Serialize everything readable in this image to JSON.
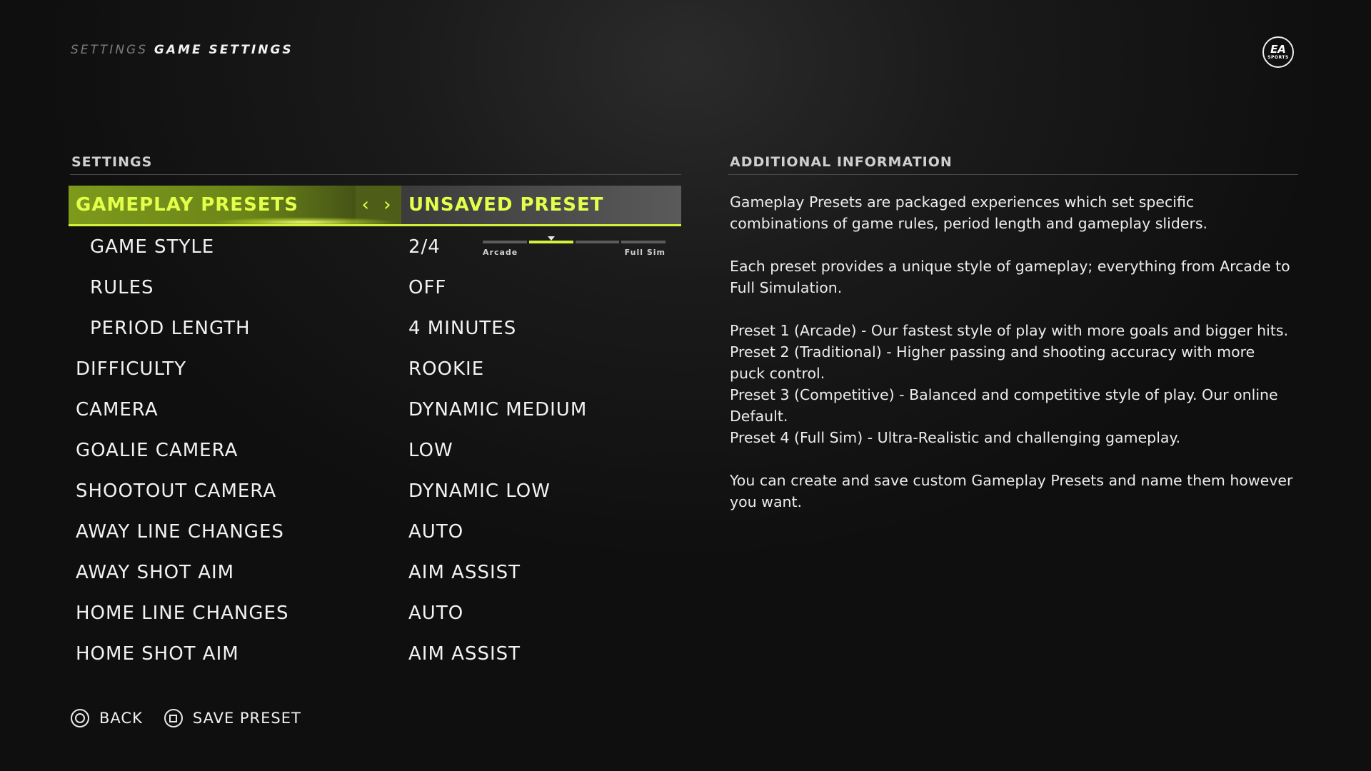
{
  "breadcrumb": {
    "parent": "SETTINGS",
    "current": "GAME SETTINGS"
  },
  "logo": {
    "line1": "EA",
    "line2": "SPORTS"
  },
  "settings_header": "SETTINGS",
  "info_header": "ADDITIONAL INFORMATION",
  "selected_row": {
    "label": "GAMEPLAY PRESETS",
    "value": "UNSAVED PRESET",
    "arrows": "‹ ›"
  },
  "game_style": {
    "label": "GAME STYLE",
    "value": "2/4",
    "slider_min_label": "Arcade",
    "slider_max_label": "Full Sim",
    "level": 2,
    "steps": 4
  },
  "rows": [
    {
      "label": "RULES",
      "value": "OFF",
      "sub": true
    },
    {
      "label": "PERIOD LENGTH",
      "value": "4 MINUTES",
      "sub": true
    },
    {
      "label": "DIFFICULTY",
      "value": "ROOKIE",
      "sub": false
    },
    {
      "label": "CAMERA",
      "value": "DYNAMIC MEDIUM",
      "sub": false
    },
    {
      "label": "GOALIE CAMERA",
      "value": "LOW",
      "sub": false
    },
    {
      "label": "SHOOTOUT CAMERA",
      "value": "DYNAMIC LOW",
      "sub": false
    },
    {
      "label": "AWAY LINE CHANGES",
      "value": "AUTO",
      "sub": false
    },
    {
      "label": "AWAY SHOT AIM",
      "value": "AIM ASSIST",
      "sub": false
    },
    {
      "label": "HOME LINE CHANGES",
      "value": "AUTO",
      "sub": false
    },
    {
      "label": "HOME SHOT AIM",
      "value": "AIM ASSIST",
      "sub": false
    }
  ],
  "info": {
    "p1": "Gameplay Presets are packaged experiences which set specific combinations of game rules, period length and gameplay sliders.",
    "p2": "Each preset provides a unique style of gameplay; everything from Arcade to Full Simulation.",
    "presets": [
      "Preset 1 (Arcade) - Our fastest style of play with more goals and bigger hits.",
      "Preset 2 (Traditional) - Higher passing and shooting accuracy with more puck control.",
      "Preset 3 (Competitive) - Balanced and competitive style of play. Our online Default.",
      "Preset 4 (Full Sim) - Ultra-Realistic and challenging gameplay."
    ],
    "p3": "You can create and save custom Gameplay Presets and name them however you want."
  },
  "footer": {
    "back_label": "BACK",
    "save_label": "SAVE PRESET"
  },
  "icons": {
    "back": "circle-button-icon",
    "save": "square-button-icon"
  },
  "colors": {
    "accent": "#d7f03a",
    "accent_text": "#e2ff4a",
    "background": "#151515"
  }
}
